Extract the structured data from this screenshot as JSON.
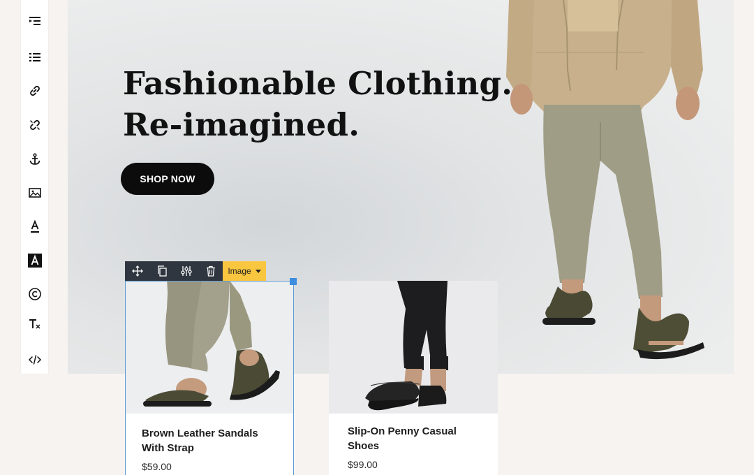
{
  "toolbar": {
    "tools": [
      {
        "icon": "indent-icon",
        "label": "Indent"
      },
      {
        "icon": "bulleted-list-icon",
        "label": "Bulleted list"
      },
      {
        "icon": "link-icon",
        "label": "Insert link"
      },
      {
        "icon": "unlink-icon",
        "label": "Remove link"
      },
      {
        "icon": "anchor-icon",
        "label": "Anchor"
      },
      {
        "icon": "image-icon",
        "label": "Insert image"
      },
      {
        "icon": "text-color-icon",
        "label": "Text color"
      },
      {
        "icon": "background-color-icon",
        "label": "Background color"
      },
      {
        "icon": "copyright-icon",
        "label": "Special character"
      },
      {
        "icon": "clear-format-icon",
        "label": "Clear formatting"
      },
      {
        "icon": "code-icon",
        "label": "Source code"
      }
    ]
  },
  "hero": {
    "title_line1": "Fashionable Clothing.",
    "title_line2": "Re-imagined.",
    "button_label": "SHOP NOW"
  },
  "element_toolbar": {
    "icons": [
      "move-icon",
      "duplicate-icon",
      "settings-icon",
      "delete-icon"
    ],
    "type_label": "Image"
  },
  "products": [
    {
      "title": "Brown Leather Sandals With Strap",
      "price": "$59.00"
    },
    {
      "title": "Slip-On Penny Casual Shoes",
      "price": "$99.00"
    }
  ],
  "colors": {
    "accent_selection": "#5b9bd5",
    "element_toolbar_bg": "#2f3640",
    "element_type_bg": "#f9c63f",
    "button_bg": "#0c0c0c"
  }
}
